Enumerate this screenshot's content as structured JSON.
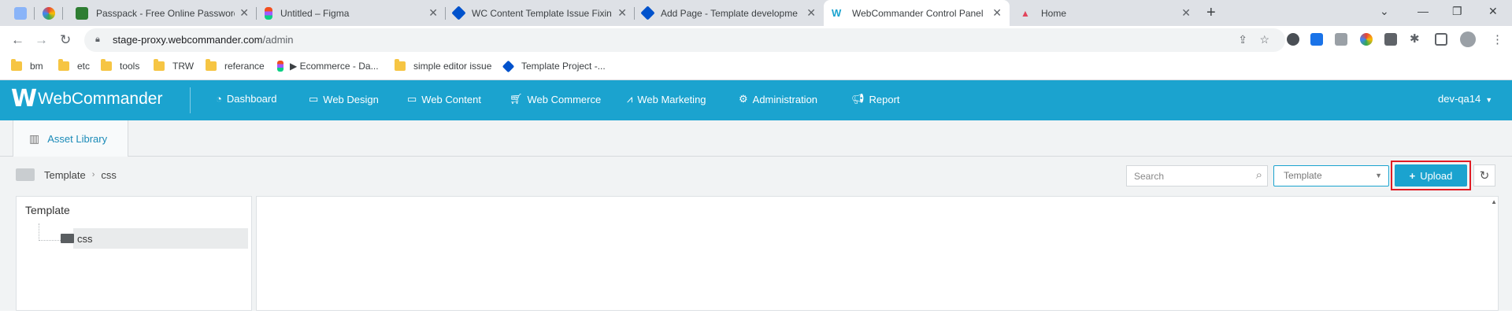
{
  "browser": {
    "tabs": [
      {
        "title": "",
        "color": "#8ab4f8"
      },
      {
        "title": "",
        "color": "#fbbc04"
      },
      {
        "title": "Passpack - Free Online Password",
        "color": "#2e7d32"
      },
      {
        "title": "Untitled – Figma",
        "color": "#f24e1e"
      },
      {
        "title": "WC Content Template Issue Fixin",
        "color": "#0052cc"
      },
      {
        "title": "Add Page - Template developme",
        "color": "#0052cc"
      },
      {
        "title": "WebCommander Control Panel",
        "color": "#1ba3cf"
      },
      {
        "title": "Home",
        "color": "#e2445c"
      }
    ],
    "active_tab_index": 6,
    "url_host": "stage-proxy.webcommander.com",
    "url_path": "/admin",
    "bookmarks": [
      {
        "label": "bm",
        "type": "folder"
      },
      {
        "label": "etc",
        "type": "folder"
      },
      {
        "label": "tools",
        "type": "folder"
      },
      {
        "label": "TRW",
        "type": "folder"
      },
      {
        "label": "referance",
        "type": "folder"
      },
      {
        "label": "▶ Ecommerce - Da...",
        "type": "figma"
      },
      {
        "label": "simple editor issue",
        "type": "folder"
      },
      {
        "label": "Template Project -...",
        "type": "confluence"
      }
    ]
  },
  "app": {
    "brand": "WebCommander",
    "menu": [
      {
        "label": "Dashboard",
        "icon": "dashboard-icon"
      },
      {
        "label": "Web Design",
        "icon": "monitor-icon"
      },
      {
        "label": "Web Content",
        "icon": "folder-icon"
      },
      {
        "label": "Web Commerce",
        "icon": "cart-icon"
      },
      {
        "label": "Web Marketing",
        "icon": "chart-icon"
      },
      {
        "label": "Administration",
        "icon": "gear-icon"
      },
      {
        "label": "Report",
        "icon": "megaphone-icon"
      }
    ],
    "user": "dev-qa14",
    "subtab": "Asset Library",
    "breadcrumb": [
      "Template",
      "css"
    ],
    "search_placeholder": "Search",
    "type_select": "Template",
    "upload_label": "Upload",
    "tree_root": "Template",
    "tree_node": "css",
    "colors": {
      "brand": "#1ba3cf",
      "highlight": "#e01c24"
    }
  }
}
